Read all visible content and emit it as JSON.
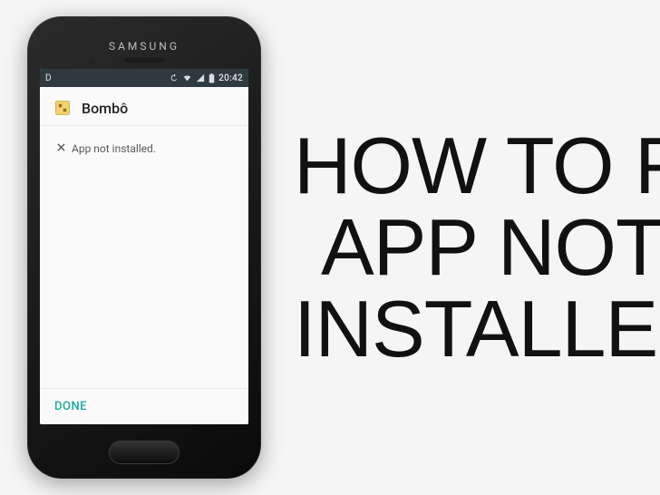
{
  "phone": {
    "brand": "SAMSUNG"
  },
  "statusbar": {
    "debug": "D",
    "time": "20:42"
  },
  "installer": {
    "app_name": "Bombô",
    "message": "App not installed.",
    "done_label": "DONE"
  },
  "headline": {
    "line1": "HOW TO FIX",
    "line2": "APP NOT",
    "line3": "INSTALLED"
  }
}
